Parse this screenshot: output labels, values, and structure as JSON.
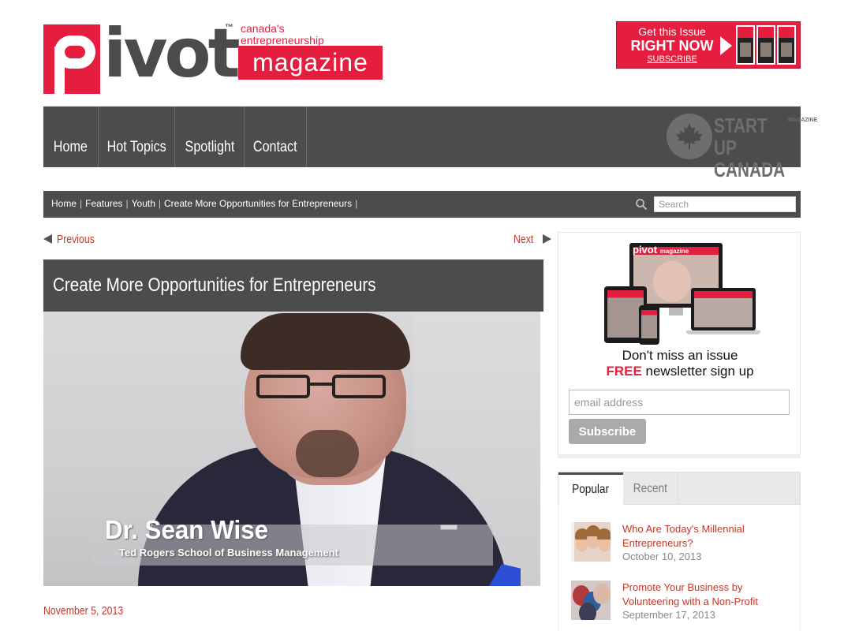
{
  "header": {
    "logo_word": "ivot",
    "logo_tm": "™",
    "logo_tag_1": "canada's",
    "logo_tag_2": "entrepreneurship",
    "logo_magazine": "magazine",
    "promo": {
      "line1": "Get this Issue",
      "line2": "RIGHT NOW",
      "line3": "SUBSCRIBE"
    }
  },
  "nav": {
    "items": [
      {
        "label": "Home"
      },
      {
        "label": "Hot Topics"
      },
      {
        "label": "Spotlight"
      },
      {
        "label": "Contact"
      }
    ],
    "brand_line1": "START UP",
    "brand_line2": "CANADA",
    "brand_vertical": "MAGAZINE"
  },
  "breadcrumb": {
    "items": [
      "Home",
      "Features",
      "Youth",
      "Create More Opportunities for Entrepreneurs"
    ],
    "separator": "|",
    "search_placeholder": "Search"
  },
  "article": {
    "prev_label": "Previous",
    "next_label": "Next",
    "title": "Create More Opportunities for Entrepreneurs",
    "video_name": "Dr. Sean Wise",
    "video_subtitle": "Ted Rogers School of Business Management",
    "date": "November 5, 2013"
  },
  "newsletter": {
    "logo_word": "pivot",
    "logo_magazine": "magazine",
    "line1": "Don't miss an issue",
    "free": "FREE",
    "line2": "newsletter sign up",
    "email_placeholder": "email address",
    "subscribe_label": "Subscribe"
  },
  "tabs": {
    "items": [
      "Popular",
      "Recent"
    ],
    "active": "Popular"
  },
  "posts": [
    {
      "title": "Who Are Today's Millennial Entrepreneurs?",
      "date": "October 10, 2013"
    },
    {
      "title": "Promote Your Business by Volunteering with a Non-Profit",
      "date": "September 17, 2013"
    }
  ],
  "colors": {
    "brand_red": "#e51d3e",
    "nav_gray": "#4c4c4e",
    "link_red": "#c0392b"
  }
}
